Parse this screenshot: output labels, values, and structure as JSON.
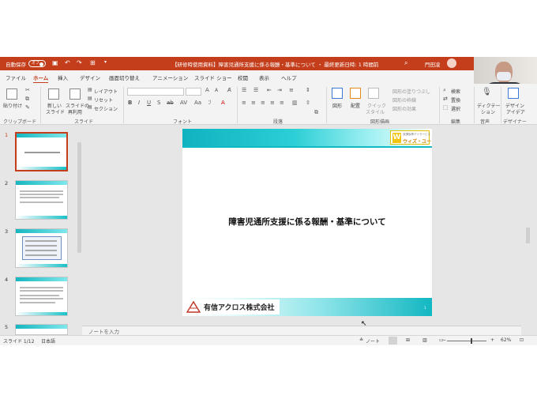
{
  "titlebar": {
    "autosave_label": "自動保存",
    "autosave_state": "オフ",
    "document_title": "【研修時使用資料】障害児通所支援に係る報酬・基準について ・ 最終更新日時: 1 時間前",
    "user_name": "門田凌"
  },
  "menu_tabs": [
    "ファイル",
    "ホーム",
    "挿入",
    "デザイン",
    "画面切り替え",
    "アニメーション",
    "スライド ショー",
    "校閲",
    "表示",
    "ヘルプ"
  ],
  "active_tab": "ホーム",
  "ribbon": {
    "paste": "貼り付け",
    "new_slide_1": "新しい",
    "new_slide_2": "スライド",
    "reuse_1": "スライドの",
    "reuse_2": "再利用",
    "layout": "レイアウト",
    "reset": "リセット",
    "section": "セクション",
    "shape": "図形",
    "arrange": "配置",
    "quick_style_1": "クイック",
    "quick_style_2": "スタイル",
    "shape_fill": "図形の塗りつぶし",
    "shape_outline": "図形の枠線",
    "shape_effect": "図形の効果",
    "find": "検索",
    "replace": "置換",
    "select": "選択",
    "dictation_1": "ディクテー",
    "dictation_2": "ション",
    "designer_1": "デザイン",
    "designer_2": "アイデア",
    "groups": {
      "clipboard": "クリップボード",
      "slides": "スライド",
      "font": "フォント",
      "paragraph": "段落",
      "drawing": "図形描画",
      "editing": "編集",
      "voice": "音声",
      "designer": "デザイナー"
    }
  },
  "thumbnails": [
    "1",
    "2",
    "3",
    "4",
    "5"
  ],
  "slide": {
    "title": "障害児通所支援に係る報酬・基準について",
    "logo_small": "放課後等デイサービス",
    "logo_brand": "ウィズ・ユー",
    "logo_letter": "W",
    "company": "有信アクロス株式会社",
    "page": "1"
  },
  "notes_placeholder": "ノートを入力",
  "status": {
    "slide_count": "スライド 1/12",
    "language": "日本語",
    "notes_button": "ノート",
    "zoom": "62%"
  },
  "colors": {
    "accent": "#c43e1c",
    "slide_band": "#12b7c2"
  }
}
